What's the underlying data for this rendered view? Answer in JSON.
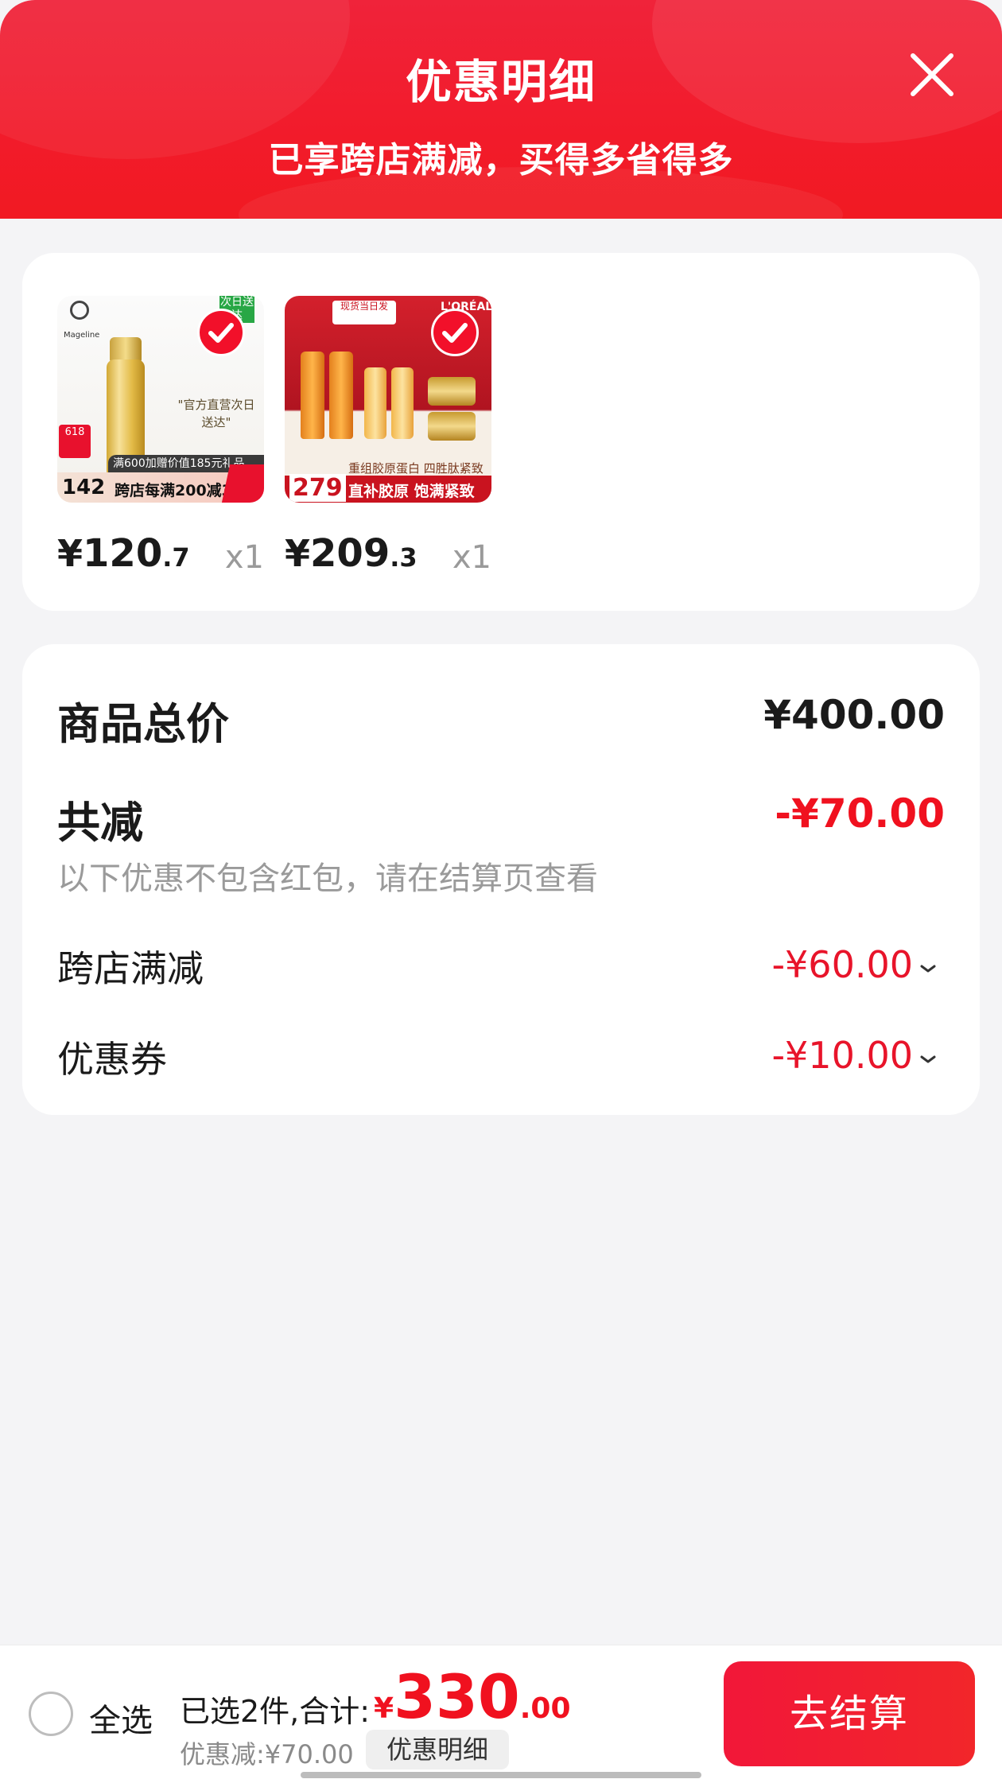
{
  "header": {
    "title": "优惠明细",
    "subtitle": "已享跨店满减，买得多省得多"
  },
  "products": [
    {
      "price_symbol": "¥",
      "price_int": "120",
      "price_dec": ".7",
      "quantity": "x1",
      "image": {
        "brand": "Mageline",
        "tag": "次日送达",
        "quote": "\"官方直营次日送达\"",
        "badge": "618",
        "promo_top": "满600加赠价值185元礼品",
        "promo_price": "142",
        "promo_text": "跨店每满200减30"
      }
    },
    {
      "price_symbol": "¥",
      "price_int": "209",
      "price_dec": ".3",
      "quantity": "x1",
      "image": {
        "brand": "L'ORÉAL",
        "top": "现货当日发",
        "sub": "重组胶原蛋白 四胜肽紧致",
        "promo_price": "279",
        "promo_text": "直补胶原 饱满紧致"
      }
    }
  ],
  "summary": {
    "total_label": "商品总价",
    "total_value": "¥400.00",
    "reduce_label": "共减",
    "reduce_value": "-¥70.00",
    "note": "以下优惠不包含红包，请在结算页查看",
    "items": [
      {
        "label": "跨店满减",
        "value": "-¥60.00"
      },
      {
        "label": "优惠券",
        "value": "-¥10.00"
      }
    ]
  },
  "bottom": {
    "select_all": "全选",
    "selected_text": "已选2件,合计:",
    "total_symbol": "¥",
    "total_int": "330",
    "total_dec": ".00",
    "discount_text": "优惠减:¥70.00",
    "detail_button": "优惠明细",
    "checkout_button": "去结算"
  },
  "colors": {
    "accent": "#f21b2b",
    "price_red": "#f0111f"
  }
}
